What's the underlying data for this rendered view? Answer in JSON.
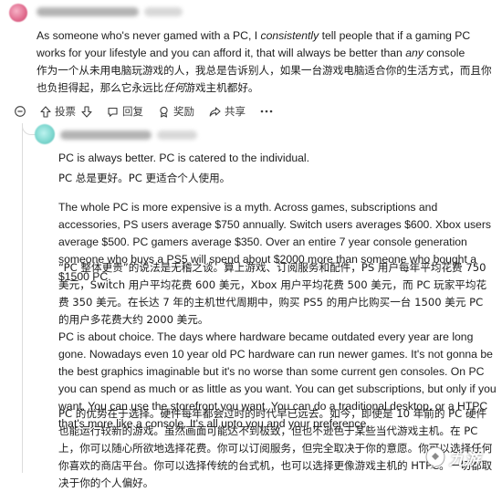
{
  "comment1": {
    "paragraphs": [
      {
        "lang": "en",
        "segments": [
          {
            "text": "As someone who's never gamed with a PC, I ",
            "em": false
          },
          {
            "text": "consistently",
            "em": true
          },
          {
            "text": " tell people that if a gaming PC works for your lifestyle and you can afford it, that will always be better than ",
            "em": false
          },
          {
            "text": "any",
            "em": true
          },
          {
            "text": " console",
            "em": false
          }
        ]
      },
      {
        "lang": "zh",
        "segments": [
          {
            "text": "作为一个从未用电脑玩游戏的人，我总是告诉别人，如果一台游戏电脑适合你的生活方式，而且你也负担得起，那么它永远比",
            "em": false
          },
          {
            "text": "任何",
            "em": true
          },
          {
            "text": "游戏主机都好。",
            "em": false
          }
        ]
      }
    ]
  },
  "actions": {
    "vote_label": "投票",
    "reply_label": "回复",
    "award_label": "奖励",
    "share_label": "共享"
  },
  "comment2": {
    "paragraphs": [
      {
        "lang": "en",
        "segments": [
          {
            "text": "PC is always better. PC is catered to the individual.",
            "em": false
          }
        ]
      },
      {
        "lang": "zh",
        "segments": [
          {
            "text": "PC 总是更好。PC 更适合个人使用。",
            "em": false
          }
        ]
      },
      {
        "lang": "en",
        "segments": [
          {
            "text": "The whole PC is more expensive is a myth. Across games, subscriptions and accessories, PS users average $750 annually. Switch users averages $600. Xbox users average $500. PC gamers average $350. Over an entire 7 year console generation someone who buys a PS5 will spend about $2000 more than someone who bought a $1500 PC.",
            "em": false
          }
        ]
      },
      {
        "lang": "zh",
        "segments": [
          {
            "text": "“PC 整体更贵”的说法是无稽之谈。算上游戏、订阅服务和配件，PS 用户每年平均花费 750 美元，Switch 用户平均花费 600 美元，Xbox 用户平均花费 500 美元，而 PC 玩家平均花费 350 美元。在长达 7 年的主机世代周期中，购买 PS5 的用户比购买一台 1500 美元 PC 的用户多花费大约 2000 美元。",
            "em": false
          }
        ]
      },
      {
        "lang": "en",
        "segments": [
          {
            "text": "PC is about choice. The days where hardware became outdated every year are long gone. Nowadays even 10 year old PC hardware can run newer games. It's not gonna be the best graphics imaginable but it's no worse than some current gen consoles. On PC you can spend as much or as little as you want. You can get subscriptions, but only if you want. You can use the storefront you want. You can do a traditional desktop, or a HTPC that's more like a console. It's all upto you and your preference.",
            "em": false
          }
        ]
      },
      {
        "lang": "zh",
        "segments": [
          {
            "text": "PC 的优势在于选择。硬件每年都会过时的时代早已远去。如今，即使是 10 年前的 PC 硬件也能运行较新的游戏。虽然画面可能达不到极致，但也不逊色于某些当代游戏主机。在 PC 上，你可以随心所欲地选择花费。你可以订阅服务，但完全取决于你的意愿。你可以选择任何你喜欢的商店平台。你可以选择传统的台式机，也可以选择更像游戏主机的 HTPC。一切都取决于你的个人偏好。",
            "em": false
          }
        ]
      }
    ]
  },
  "watermark": {
    "text": "九游"
  }
}
